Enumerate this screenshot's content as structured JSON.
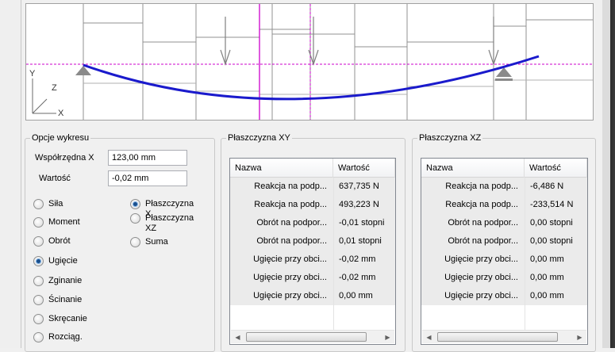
{
  "options": {
    "title": "Opcje wykresu",
    "coord_label": "Współrzędna X",
    "coord_value": "123,00 mm",
    "value_label": "Wartość",
    "value_value": "-0,02 mm",
    "quantities": [
      {
        "label": "Siła",
        "checked": false
      },
      {
        "label": "Moment",
        "checked": false
      },
      {
        "label": "Obrót",
        "checked": false
      },
      {
        "label": "Ugięcie",
        "checked": true
      },
      {
        "label": "Zginanie",
        "checked": false
      },
      {
        "label": "Ścinanie",
        "checked": false
      },
      {
        "label": "Skręcanie",
        "checked": false
      },
      {
        "label": "Rozciąg.",
        "checked": false
      }
    ],
    "planes": [
      {
        "label": "Płaszczyzna X",
        "checked": true
      },
      {
        "label": "Płaszczyzna XZ",
        "checked": false
      },
      {
        "label": "Suma",
        "checked": false
      }
    ]
  },
  "diagram": {
    "axis_y": "Y",
    "axis_z": "Z",
    "axis_x": "X",
    "colors": {
      "beam": "#1a1acc",
      "guide": "#cc00cc",
      "grid": "#909090",
      "support": "#8a8a8a"
    }
  },
  "plane_xy": {
    "title": "Płaszczyzna XY",
    "col_name": "Nazwa",
    "col_value": "Wartość",
    "rows": [
      {
        "name": "Reakcja na podp...",
        "value": "637,735 N"
      },
      {
        "name": "Reakcja na podp...",
        "value": "493,223 N"
      },
      {
        "name": "Obrót na podpor...",
        "value": "-0,01 stopni"
      },
      {
        "name": "Obrót na podpor...",
        "value": "0,01 stopni"
      },
      {
        "name": "Ugięcie przy obci...",
        "value": "-0,02 mm"
      },
      {
        "name": "Ugięcie przy obci...",
        "value": "-0,02 mm"
      },
      {
        "name": "Ugięcie przy obci...",
        "value": "0,00 mm"
      }
    ]
  },
  "plane_xz": {
    "title": "Płaszczyzna XZ",
    "col_name": "Nazwa",
    "col_value": "Wartość",
    "rows": [
      {
        "name": "Reakcja na podp...",
        "value": "-6,486 N"
      },
      {
        "name": "Reakcja na podp...",
        "value": "-233,514 N"
      },
      {
        "name": "Obrót na podpor...",
        "value": "0,00 stopni"
      },
      {
        "name": "Obrót na podpor...",
        "value": "0,00 stopni"
      },
      {
        "name": "Ugięcie przy obci...",
        "value": "0,00 mm"
      },
      {
        "name": "Ugięcie przy obci...",
        "value": "0,00 mm"
      },
      {
        "name": "Ugięcie przy obci...",
        "value": "0,00 mm"
      }
    ]
  }
}
